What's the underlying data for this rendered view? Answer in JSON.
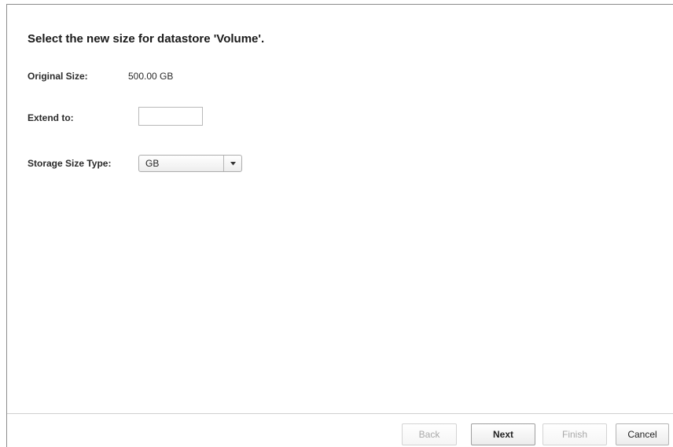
{
  "wizard": {
    "heading": "Select the new size for datastore 'Volume'.",
    "original_size": {
      "label": "Original Size:",
      "value": "500.00 GB"
    },
    "extend_to": {
      "label": "Extend to:",
      "value": "",
      "placeholder": ""
    },
    "storage_size_type": {
      "label": "Storage Size Type:",
      "selected": "GB",
      "icon": "chevron-down-icon"
    }
  },
  "footer": {
    "back_label": "Back",
    "back_enabled": false,
    "next_label": "Next",
    "next_enabled": true,
    "finish_label": "Finish",
    "finish_enabled": false,
    "cancel_label": "Cancel",
    "cancel_enabled": true
  }
}
